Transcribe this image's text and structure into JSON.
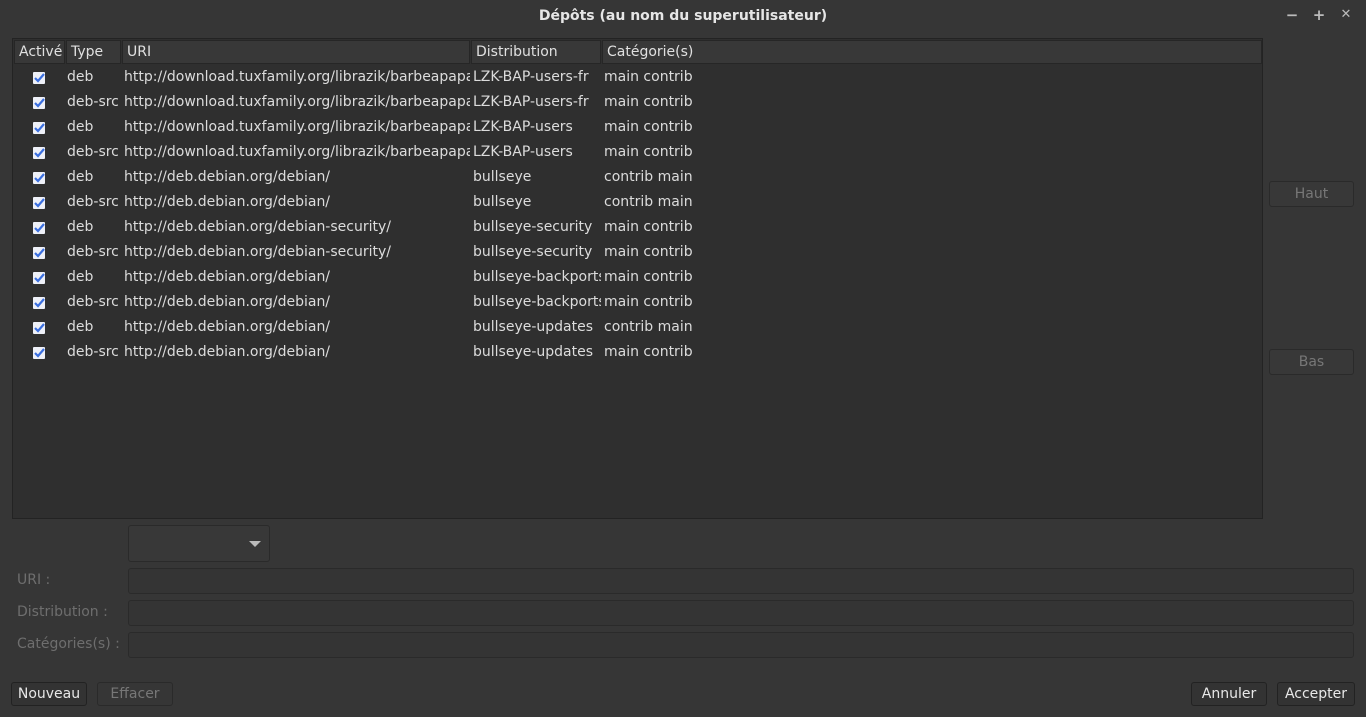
{
  "window": {
    "title": "Dépôts (au nom du superutilisateur)",
    "minimize": "−",
    "maximize": "+",
    "close": "✕"
  },
  "table": {
    "headers": [
      "Activé",
      "Type",
      "URI",
      "Distribution",
      "Catégorie(s)"
    ],
    "rows": [
      {
        "enabled": true,
        "type": "deb",
        "uri": "http://download.tuxfamily.org/librazik/barbeapapas/",
        "dist": "LZK-BAP-users-fr",
        "cat": "main contrib"
      },
      {
        "enabled": true,
        "type": "deb-src",
        "uri": "http://download.tuxfamily.org/librazik/barbeapapas/",
        "dist": "LZK-BAP-users-fr",
        "cat": "main contrib"
      },
      {
        "enabled": true,
        "type": "deb",
        "uri": "http://download.tuxfamily.org/librazik/barbeapapas/",
        "dist": "LZK-BAP-users",
        "cat": "main contrib"
      },
      {
        "enabled": true,
        "type": "deb-src",
        "uri": "http://download.tuxfamily.org/librazik/barbeapapas/",
        "dist": "LZK-BAP-users",
        "cat": "main contrib"
      },
      {
        "enabled": true,
        "type": "deb",
        "uri": "http://deb.debian.org/debian/",
        "dist": "bullseye",
        "cat": "contrib main"
      },
      {
        "enabled": true,
        "type": "deb-src",
        "uri": "http://deb.debian.org/debian/",
        "dist": "bullseye",
        "cat": "contrib main"
      },
      {
        "enabled": true,
        "type": "deb",
        "uri": "http://deb.debian.org/debian-security/",
        "dist": "bullseye-security",
        "cat": "main contrib"
      },
      {
        "enabled": true,
        "type": "deb-src",
        "uri": "http://deb.debian.org/debian-security/",
        "dist": "bullseye-security",
        "cat": "main contrib"
      },
      {
        "enabled": true,
        "type": "deb",
        "uri": "http://deb.debian.org/debian/",
        "dist": "bullseye-backports",
        "cat": "main contrib"
      },
      {
        "enabled": true,
        "type": "deb-src",
        "uri": "http://deb.debian.org/debian/",
        "dist": "bullseye-backports",
        "cat": "main contrib"
      },
      {
        "enabled": true,
        "type": "deb",
        "uri": "http://deb.debian.org/debian/",
        "dist": "bullseye-updates",
        "cat": "contrib main"
      },
      {
        "enabled": true,
        "type": "deb-src",
        "uri": "http://deb.debian.org/debian/",
        "dist": "bullseye-updates",
        "cat": "main contrib"
      }
    ]
  },
  "side": {
    "up": "Haut",
    "down": "Bas"
  },
  "form": {
    "uri_label": "URI :",
    "dist_label": "Distribution :",
    "cat_label": "Catégories(s) :",
    "uri": "",
    "dist": "",
    "cat": ""
  },
  "buttons": {
    "new": "Nouveau",
    "delete": "Effacer",
    "cancel": "Annuler",
    "accept": "Accepter"
  },
  "colors": {
    "check": "#3b6fe0"
  }
}
